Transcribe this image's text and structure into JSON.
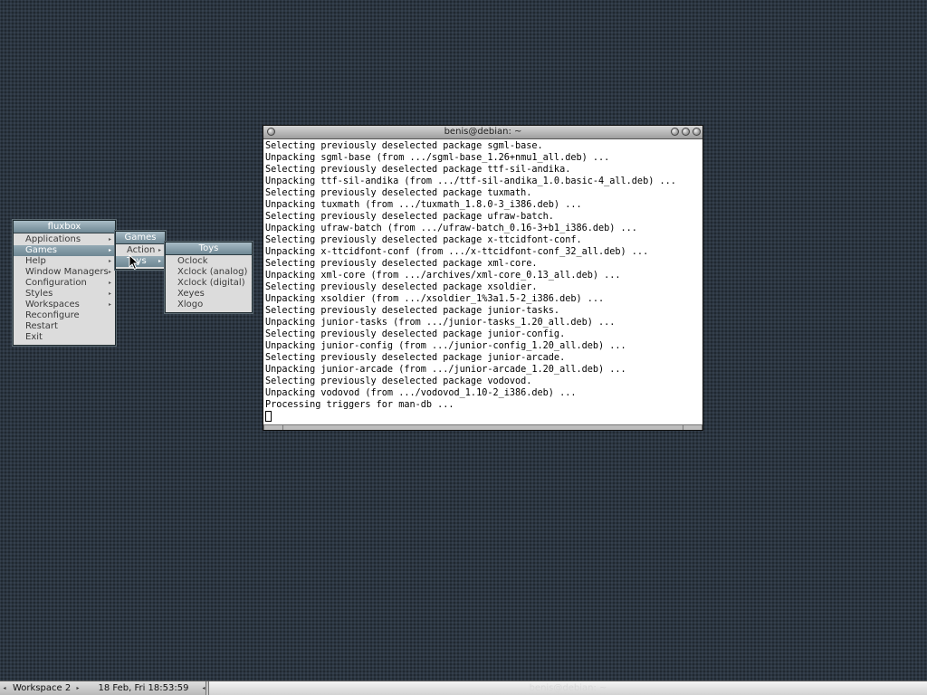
{
  "root_menu": {
    "title": "fluxbox",
    "items": [
      {
        "label": "Applications",
        "submenu": true
      },
      {
        "label": "Games",
        "submenu": true,
        "active": true
      },
      {
        "label": "Help",
        "submenu": true
      },
      {
        "label": "Window Managers",
        "submenu": true
      },
      {
        "label": "Configuration",
        "submenu": true
      },
      {
        "label": "Styles",
        "submenu": true
      },
      {
        "label": "Workspaces",
        "submenu": true
      },
      {
        "label": "Reconfigure",
        "submenu": false
      },
      {
        "label": "Restart",
        "submenu": false
      },
      {
        "label": "Exit",
        "submenu": false
      }
    ]
  },
  "games_menu": {
    "title": "Games",
    "items": [
      {
        "label": "Action",
        "submenu": true
      },
      {
        "label": "Toys",
        "submenu": true,
        "active": true
      }
    ]
  },
  "toys_menu": {
    "title": "Toys",
    "items": [
      {
        "label": "Oclock"
      },
      {
        "label": "Xclock (analog)"
      },
      {
        "label": "Xclock (digital)"
      },
      {
        "label": "Xeyes"
      },
      {
        "label": "Xlogo"
      }
    ]
  },
  "terminal": {
    "title": "benis@debian: ~",
    "lines": [
      "Selecting previously deselected package sgml-base.",
      "Unpacking sgml-base (from .../sgml-base_1.26+nmu1_all.deb) ...",
      "Selecting previously deselected package ttf-sil-andika.",
      "Unpacking ttf-sil-andika (from .../ttf-sil-andika_1.0.basic-4_all.deb) ...",
      "Selecting previously deselected package tuxmath.",
      "Unpacking tuxmath (from .../tuxmath_1.8.0-3_i386.deb) ...",
      "Selecting previously deselected package ufraw-batch.",
      "Unpacking ufraw-batch (from .../ufraw-batch_0.16-3+b1_i386.deb) ...",
      "Selecting previously deselected package x-ttcidfont-conf.",
      "Unpacking x-ttcidfont-conf (from .../x-ttcidfont-conf_32_all.deb) ...",
      "Selecting previously deselected package xml-core.",
      "Unpacking xml-core (from .../archives/xml-core_0.13_all.deb) ...",
      "Selecting previously deselected package xsoldier.",
      "Unpacking xsoldier (from .../xsoldier_1%3a1.5-2_i386.deb) ...",
      "Selecting previously deselected package junior-tasks.",
      "Unpacking junior-tasks (from .../junior-tasks_1.20_all.deb) ...",
      "Selecting previously deselected package junior-config.",
      "Unpacking junior-config (from .../junior-config_1.20_all.deb) ...",
      "Selecting previously deselected package junior-arcade.",
      "Unpacking junior-arcade (from .../junior-arcade_1.20_all.deb) ...",
      "Selecting previously deselected package vodovod.",
      "Unpacking vodovod (from .../vodovod_1.10-2_i386.deb) ...",
      "Processing triggers for man-db ..."
    ]
  },
  "toolbar": {
    "workspace": "Workspace 2",
    "clock": "18 Feb, Fri 18:53:59",
    "window_title": "benis@debian: ~"
  },
  "colors": {
    "desktop": "#2b3540",
    "menu_title": "#7f97a3",
    "menu_active": "#7f97a3",
    "menu_bg": "#dcdcdc"
  }
}
